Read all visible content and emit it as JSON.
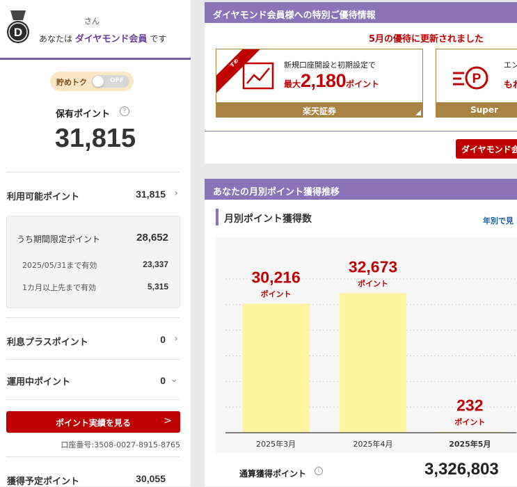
{
  "member": {
    "honorific": "さん",
    "prefix": "あなたは",
    "tier": "ダイヤモンド会員",
    "suffix": "です",
    "badge_letter": "D"
  },
  "savings_toggle": {
    "label": "貯めトク",
    "state": "OFF"
  },
  "held_points": {
    "label": "保有ポイント",
    "value": "31,815"
  },
  "available": {
    "label": "利用可能ポイント",
    "value": "31,815"
  },
  "limited": {
    "label": "うち期間限定ポイント",
    "value": "28,652",
    "items": [
      {
        "label": "2025/05/31まで有効",
        "value": "23,337"
      },
      {
        "label": "1カ月以上先まで有効",
        "value": "5,315"
      }
    ]
  },
  "interest_plus": {
    "label": "利息プラスポイント",
    "value": "0"
  },
  "investing": {
    "label": "運用中ポイント",
    "value": "0"
  },
  "cta": {
    "label": "ポイント実績を見る",
    "arrow": ">"
  },
  "account_number": "口座番号:3508-0027-8915-8765",
  "expected": {
    "label": "獲得予定ポイント",
    "value": "30,055"
  },
  "offers": {
    "header": "ダイヤモンド会員様への特別ご優待情報",
    "updated": "5月の優待に更新されました",
    "ribbon": "今月の おすすめ",
    "card1": {
      "line1": "新規口座開設と初期設定で",
      "prefix": "最大",
      "amount": "2,180",
      "suffix": "ポイント",
      "footer": "楽天証券"
    },
    "card2": {
      "line1": "エン",
      "line2": "もれ",
      "footer": "Super"
    },
    "button": "ダイヤモンド会"
  },
  "monthly": {
    "header": "あなたの月別ポイント獲得推移",
    "subtitle": "月別ポイント獲得数",
    "yearly_link": "年別で見",
    "total_label": "通算獲得ポイント",
    "total_value": "3,326,803"
  },
  "chart_data": {
    "type": "bar",
    "categories": [
      "2025年3月",
      "2025年4月",
      "2025年5月"
    ],
    "values": [
      30216,
      32673,
      232
    ],
    "value_labels": [
      "30,216",
      "32,673",
      "232"
    ],
    "unit_label": "ポイント",
    "ylim": [
      0,
      36000
    ],
    "bar_color": "#fff3a0",
    "label_color": "#bf0000",
    "bold_category_index": 2
  }
}
